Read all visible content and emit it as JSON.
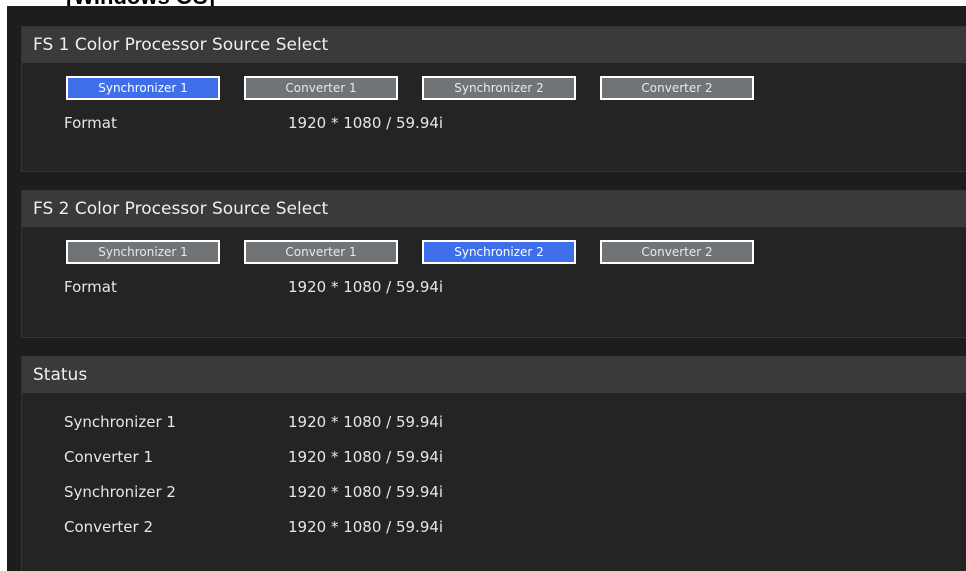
{
  "heading": "[Windows OS]",
  "fs1": {
    "title": "FS 1 Color Processor Source Select",
    "buttons": [
      {
        "label": "Synchronizer 1",
        "active": true
      },
      {
        "label": "Converter 1",
        "active": false
      },
      {
        "label": "Synchronizer 2",
        "active": false
      },
      {
        "label": "Converter 2",
        "active": false
      }
    ],
    "format_label": "Format",
    "format_value": "1920 * 1080 / 59.94i"
  },
  "fs2": {
    "title": "FS 2 Color Processor Source Select",
    "buttons": [
      {
        "label": "Synchronizer 1",
        "active": false
      },
      {
        "label": "Converter 1",
        "active": false
      },
      {
        "label": "Synchronizer 2",
        "active": true
      },
      {
        "label": "Converter 2",
        "active": false
      }
    ],
    "format_label": "Format",
    "format_value": "1920 * 1080 / 59.94i"
  },
  "status": {
    "title": "Status",
    "rows": [
      {
        "label": "Synchronizer 1",
        "value": "1920 * 1080 / 59.94i"
      },
      {
        "label": "Converter 1",
        "value": "1920 * 1080 / 59.94i"
      },
      {
        "label": "Synchronizer 2",
        "value": "1920 * 1080 / 59.94i"
      },
      {
        "label": "Converter 2",
        "value": "1920 * 1080 / 59.94i"
      }
    ]
  },
  "colors": {
    "active_button": "#3f6fe8",
    "inactive_button": "#707477",
    "panel_header": "#3a3a3a",
    "background": "#1d1d1d"
  }
}
